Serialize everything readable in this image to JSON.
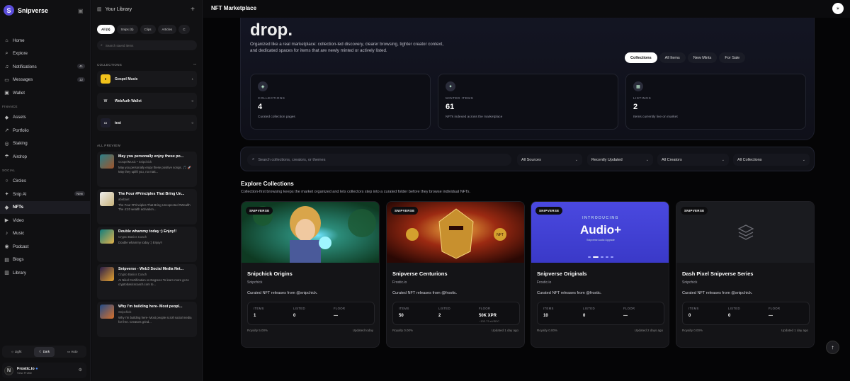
{
  "app": {
    "brand": "Snipverse",
    "page_title": "NFT Marketplace"
  },
  "nav": {
    "items": [
      {
        "label": "Home",
        "icon": "home-icon",
        "glyph": "⌂"
      },
      {
        "label": "Explore",
        "icon": "search-icon",
        "glyph": "⌕"
      },
      {
        "label": "Notifications",
        "icon": "bell-icon",
        "glyph": "♫",
        "badge": "41"
      },
      {
        "label": "Messages",
        "icon": "message-icon",
        "glyph": "▭",
        "badge": "12"
      },
      {
        "label": "Wallet",
        "icon": "wallet-icon",
        "glyph": "▣"
      }
    ],
    "finance_label": "FINANCE",
    "finance": [
      {
        "label": "Assets",
        "icon": "assets-icon",
        "glyph": "◆"
      },
      {
        "label": "Portfolio",
        "icon": "chart-icon",
        "glyph": "↗"
      },
      {
        "label": "Staking",
        "icon": "staking-icon",
        "glyph": "◎"
      },
      {
        "label": "Airdrop",
        "icon": "airdrop-icon",
        "glyph": "☂"
      }
    ],
    "social_label": "SOCIAL",
    "social": [
      {
        "label": "Circles",
        "icon": "circles-icon",
        "glyph": "○"
      },
      {
        "label": "Snip AI",
        "icon": "ai-icon",
        "glyph": "✦",
        "badge": "New"
      },
      {
        "label": "NFTs",
        "icon": "diamond-icon",
        "glyph": "◆"
      },
      {
        "label": "Video",
        "icon": "video-icon",
        "glyph": "▶"
      },
      {
        "label": "Music",
        "icon": "music-icon",
        "glyph": "♪"
      },
      {
        "label": "Podcast",
        "icon": "podcast-icon",
        "glyph": "◉"
      },
      {
        "label": "Blogs",
        "icon": "blog-icon",
        "glyph": "▤"
      },
      {
        "label": "Library",
        "icon": "library-icon",
        "glyph": "▥"
      }
    ],
    "theme": {
      "light": "Light",
      "dark": "Dark",
      "auto": "Auto"
    },
    "user": {
      "name": "Frostic.io",
      "sub": "View Profile",
      "initial": "N"
    }
  },
  "library": {
    "title": "Your Library",
    "chips": [
      "All (5)",
      "Snips (5)",
      "Clips",
      "Articles",
      "C"
    ],
    "search_placeholder": "Search saved items",
    "collections_label": "COLLECTIONS",
    "collections": [
      {
        "name": "Gospel Music",
        "count": "1",
        "color": "#f2c21b"
      },
      {
        "name": "WebAuth Wallet",
        "count": "0",
        "color": "#ffffff"
      },
      {
        "name": "test",
        "count": "0",
        "color": "#1e1e2c"
      }
    ],
    "preview_label": "ALL PREVIEW",
    "previews": [
      {
        "title": "May you personally enjoy these po...",
        "sub": "GospelMusic • Snipchick",
        "body": "May you personally enjoy these positive songs. 🎵 🚀 May they uplift you, no matt..."
      },
      {
        "title": "The Four #Principles That Bring Un...",
        "sub": "abebaet",
        "body": "The Four #Principles That Bring Unexpected #Wealth The 4:20 wealth activation..."
      },
      {
        "title": "Double whammy today :) Enjoy!!",
        "sub": "Crypto Basics Coach",
        "body": "Double whammy today :) Enjoy!!"
      },
      {
        "title": "Snipverse - Web3 Social Media Net...",
        "sub": "Crypto Basics Coach",
        "body": "AI Nikol Certification vs Degrees To learn more go to cryptobasicscoach.com to..."
      },
      {
        "title": "Why I'm building here- Most peopl...",
        "sub": "Snipchick",
        "body": "Why I'm building here- Most people scroll social media for free. Creators grind..."
      }
    ]
  },
  "hero": {
    "big": "drop.",
    "desc": "Organized like a real marketplace: collection-led discovery, clearer browsing, tighter creator context, and dedicated spaces for items that are newly minted or actively listed.",
    "tabs": [
      "Collections",
      "All Items",
      "New Mints",
      "For Sale"
    ],
    "stats": [
      {
        "label": "COLLECTIONS",
        "value": "4",
        "desc": "Curated collection pages",
        "icon": "layers-icon",
        "glyph": "◈"
      },
      {
        "label": "MINTED ITEMS",
        "value": "61",
        "desc": "NFTs indexed across the marketplace",
        "icon": "sparkle-icon",
        "glyph": "✦"
      },
      {
        "label": "LISTINGS",
        "value": "2",
        "desc": "Items currently live on market",
        "icon": "store-icon",
        "glyph": "▦"
      }
    ]
  },
  "filters": {
    "search_placeholder": "Search collections, creators, or themes",
    "sources": "All Sources",
    "sort": "Recently Updated",
    "creators": "All Creators",
    "collections": "All Collections"
  },
  "explore": {
    "title": "Explore Collections",
    "desc": "Collection-first browsing keeps the market organized and lets collectors step into a curated folder before they browse individual NFTs.",
    "cards": [
      {
        "tag": "SNIPVERSE",
        "title": "Snipchick Origins",
        "creator": "Snipchick",
        "desc": "Curated NFT releases from @snipchick.",
        "items_label": "ITEMS",
        "items": "1",
        "listed_label": "LISTED",
        "listed": "0",
        "floor_label": "FLOOR",
        "floor": "—",
        "floor_sub": "",
        "royalty": "Royalty 5.00%",
        "updated": "Updated today"
      },
      {
        "tag": "SNIPVERSE",
        "title": "Snipverse Centurions",
        "creator": "Frostic.io",
        "desc": "Curated NFT releases from @frostic.",
        "items_label": "ITEMS",
        "items": "50",
        "listed_label": "LISTED",
        "listed": "2",
        "floor_label": "FLOOR",
        "floor": "50K XPR",
        "floor_sub": "~132.73 xUSDC",
        "royalty": "Royalty 0.00%",
        "updated": "Updated 1 day ago"
      },
      {
        "tag": "SNIPVERSE",
        "title": "Snipverse Originals",
        "creator": "Frostic.io",
        "desc": "Curated NFT releases from @frostic.",
        "items_label": "ITEMS",
        "items": "10",
        "listed_label": "LISTED",
        "listed": "0",
        "floor_label": "FLOOR",
        "floor": "—",
        "floor_sub": "",
        "royalty": "Royalty 0.00%",
        "updated": "Updated 2 days ago",
        "banner_top": "INTRODUCING",
        "banner_main": "Audio+",
        "banner_sub": "Snipverse Audio Upgrade"
      },
      {
        "tag": "SNIPVERSE",
        "title": "Dash Pixel Snipverse Series",
        "creator": "Snipchick",
        "desc": "Curated NFT releases from @snipchick.",
        "items_label": "ITEMS",
        "items": "0",
        "listed_label": "LISTED",
        "listed": "0",
        "floor_label": "FLOOR",
        "floor": "—",
        "floor_sub": "",
        "royalty": "Royalty 0.00%",
        "updated": "Updated 1 day ago"
      }
    ]
  },
  "colors": {
    "accent": "#5b4ddb",
    "audio_banner": "#3a39c8"
  }
}
